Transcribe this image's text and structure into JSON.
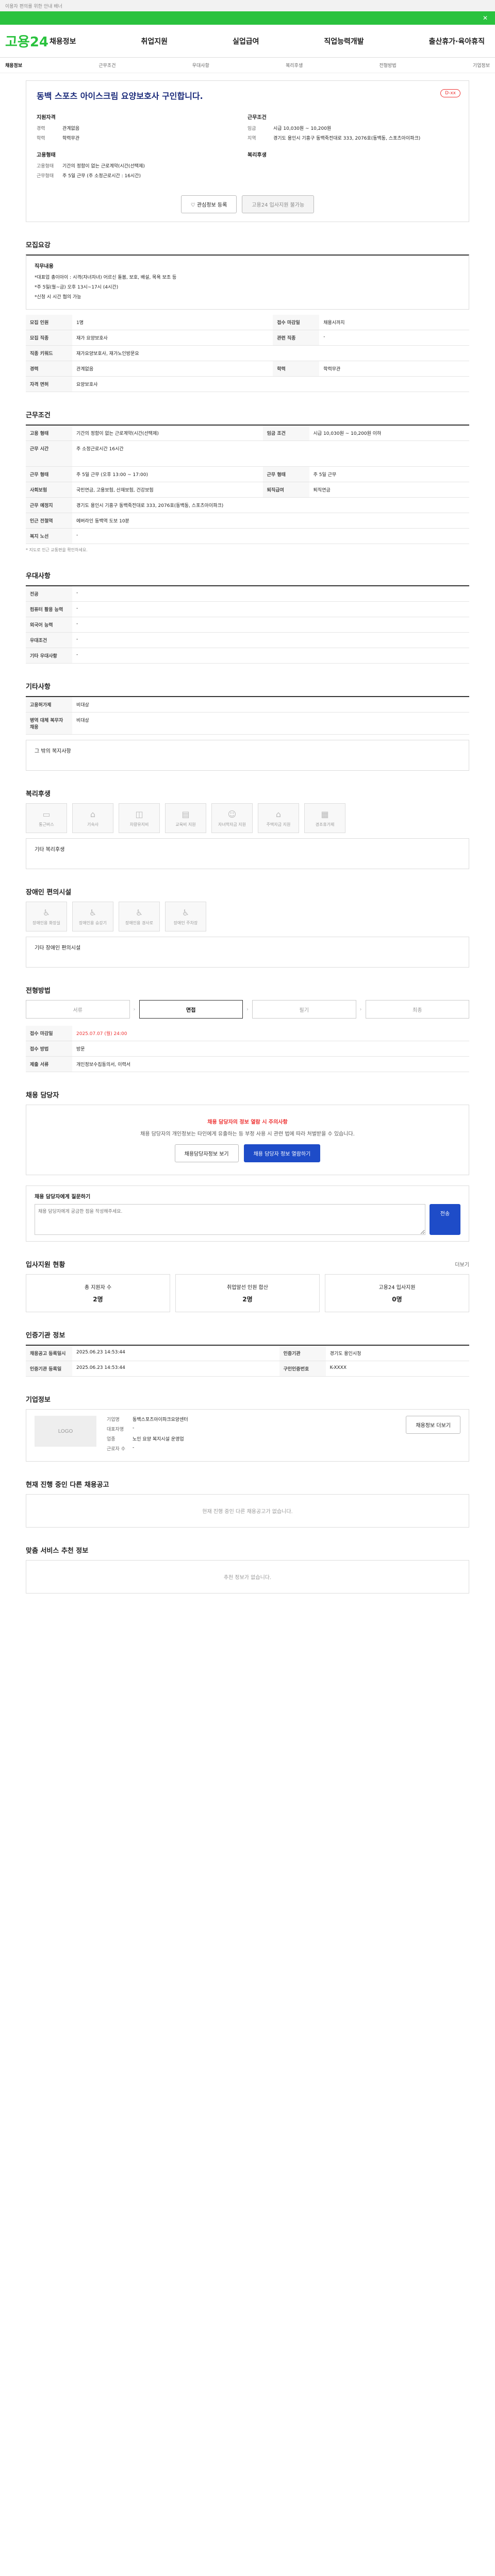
{
  "topbar": {
    "text": "이용자 편의를 위한 안내 배너"
  },
  "banner": {
    "close": "✕"
  },
  "header": {
    "logo_main": "고용",
    "logo_num": "24",
    "gnb": [
      "채용정보",
      "취업지원",
      "실업급여",
      "직업능력개발",
      "출산휴가·육아휴직"
    ]
  },
  "subnav": [
    "채용정보",
    "근무조건",
    "우대사항",
    "복리후생",
    "전형방법",
    "기업정보"
  ],
  "job": {
    "title": "동백 스포츠 아이스크림 요양보호사 구인합니다.",
    "status": "D-xx",
    "left_head": "지원자격",
    "left": [
      {
        "k": "경력",
        "v": "관계없음"
      },
      {
        "k": "학력",
        "v": "학력무관"
      }
    ],
    "left_head2": "고용형태",
    "left2": [
      {
        "k": "고용형태",
        "v": "기간의 정함이 없는 근로계약(시간(선택제)"
      },
      {
        "k": "근무형태",
        "v": "주 5일 근무 (주 소정근로시간 : 16시간)"
      }
    ],
    "right_head": "근무조건",
    "right": [
      {
        "k": "임금",
        "v": "시급 10,030원 ~ 10,200원"
      },
      {
        "k": "지역",
        "v": "경기도 용인시 기흥구 동백죽전대로 333, 2076호(동백동, 스포츠아이파크)"
      }
    ],
    "right_head2": "복리후생",
    "btn_interest": "관심정보 등록",
    "btn_apply": "고용24 입사지원 불가능"
  },
  "recruit": {
    "title": "모집요강",
    "duty_head": "직무내용",
    "duty_lines": [
      "*대표업 총이아이 : 시격(자녀자녀) 어르신 돌봄, 보호, 배설, 목욕 보조 등",
      "*주 5일(월~금) 오후 13시~17시 (4시간)",
      "*신청 시 시간 협의 가능"
    ],
    "rows": [
      [
        {
          "k": "모집 인원",
          "v": "1명"
        },
        {
          "k": "접수 마감일",
          "v": "채용시까지"
        }
      ],
      [
        {
          "k": "모집 직종",
          "v": "재가 요양보호사"
        },
        {
          "k": "관련 직종",
          "v": "-"
        }
      ],
      [
        {
          "k": "직종 키워드",
          "v": "재가요양보호사, 재가노인방문요"
        },
        {
          "k": "",
          "v": ""
        }
      ],
      [
        {
          "k": "경력",
          "v": "관계없음"
        },
        {
          "k": "학력",
          "v": "학력무관"
        }
      ],
      [
        {
          "k": "자격 면허",
          "v": "요양보호사"
        },
        {
          "k": "",
          "v": ""
        }
      ]
    ]
  },
  "work": {
    "title": "근무조건",
    "rows": [
      [
        {
          "k": "고용 형태",
          "v": "기간의 정함이 없는 근로계약(시간(선택제)"
        },
        {
          "k": "임금 조건",
          "v": "시급 10,030원 ~ 10,200원 이하"
        }
      ],
      [
        {
          "k": "근무 시간",
          "v": "주 소정근로시간 16시간"
        },
        {
          "k": "",
          "v": ""
        }
      ],
      [
        {
          "k": "근무 형태",
          "v": "주 5일 근무 (오후 13:00 ~ 17:00)"
        },
        {
          "k": "근무 형태",
          "v": "주 5일 근무"
        }
      ],
      [
        {
          "k": "사회보험",
          "v": "국민연금, 고용보험, 산재보험, 건강보험"
        },
        {
          "k": "퇴직급여",
          "v": "퇴직연금"
        }
      ],
      [
        {
          "k": "근무 예정지",
          "v": "경기도 용인시 기흥구 동백죽전대로 333, 2076호(동백동, 스포츠아이파크)"
        },
        {
          "k": "",
          "v": ""
        }
      ],
      [
        {
          "k": "인근 전철역",
          "v": "에버라인 동백역 도보 10분"
        },
        {
          "k": "",
          "v": ""
        }
      ],
      [
        {
          "k": "복지 노선",
          "v": "-"
        },
        {
          "k": "",
          "v": ""
        }
      ]
    ],
    "note": "* 지도로 인근 교통편을 확인하세요."
  },
  "pref": {
    "title": "우대사항",
    "rows": [
      {
        "k": "전공",
        "v": "-"
      },
      {
        "k": "컴퓨터 활용 능력",
        "v": "-"
      },
      {
        "k": "외국어 능력",
        "v": "-"
      },
      {
        "k": "우대조건",
        "v": "-"
      },
      {
        "k": "기타 우대사항",
        "v": "-"
      }
    ]
  },
  "etc": {
    "title": "기타사항",
    "rows": [
      {
        "k": "고용허가제",
        "v": "비대상"
      },
      {
        "k": "병역 대체 복무자 채용",
        "v": "비대상"
      }
    ]
  },
  "etc_box": "그 밖의 복지사항",
  "welfare": {
    "title": "복리후생",
    "icons": [
      "통근버스",
      "기숙사",
      "차량유지비",
      "교육비 지원",
      "자녀학자금 지원",
      "주택자금 지원",
      "경조휴가제"
    ],
    "box": "기타 복리후생"
  },
  "disabled": {
    "title": "장애인 편의시설",
    "icons": [
      "장애인용 화장실",
      "장애인용 승강기",
      "장애인용 경사로",
      "장애인 주차장"
    ],
    "box": "기타 장애인 편의시설"
  },
  "screening": {
    "title": "전형방법",
    "steps": [
      "서류",
      "면접",
      "필기",
      "최종"
    ],
    "rows": [
      {
        "k": "접수 마감일",
        "v": "2025.07.07 (월) 24:00"
      },
      {
        "k": "접수 방법",
        "v": "방문"
      },
      {
        "k": "제출 서류",
        "v": "개인정보수집동의서, 이력서"
      }
    ]
  },
  "manager": {
    "title": "채용 담당자",
    "warn_title": "채용 담당자의 정보 열람 시 주의사항",
    "warn_text": "채용 담당자의 개인정보는 타인에게 유출하는 등 부정 사용 시 관련 법에 따라 처벌받을 수 있습니다.",
    "btn1": "채용담당자정보 보기",
    "btn2": "채용 담당자 정보 열람하기"
  },
  "opinion": {
    "title": "채용 담당자에게 질문하기",
    "placeholder": "채용 담당자에게 궁금한 점을 작성해주세요.",
    "btn": "전송"
  },
  "apply_status": {
    "title": "입사지원 현황",
    "more": "더보기",
    "stats": [
      {
        "k": "총 지원자 수",
        "v": "2명"
      },
      {
        "k": "취업알선 인원 합산",
        "v": "2명"
      },
      {
        "k": "고용24 입사지원",
        "v": "0명"
      }
    ]
  },
  "authority": {
    "title": "인증기관 정보",
    "rows": [
      [
        {
          "k": "채용공고 등록일시",
          "v": "2025.06.23 14:53:44"
        },
        {
          "k": "인증기관",
          "v": "경기도 용인시청"
        }
      ],
      [
        {
          "k": "인증기관 등록일",
          "v": "2025.06.23 14:53:44"
        },
        {
          "k": "구인인증번호",
          "v": "K-XXXX"
        }
      ]
    ]
  },
  "company": {
    "title": "기업정보",
    "logo": "LOGO",
    "rows": [
      {
        "k": "기업명",
        "v": "동백스포츠아이파크요양센터"
      },
      {
        "k": "대표자명",
        "v": "-"
      },
      {
        "k": "업종",
        "v": "노인 요양 복지시설 운영업"
      },
      {
        "k": "근로자 수",
        "v": "-"
      }
    ],
    "btn_more": "채용정보 더보기"
  },
  "ongoing": {
    "title": "현재 진행 중인 다른 채용공고",
    "empty": "현재 진행 중인 다른 채용공고가 없습니다."
  },
  "similar": {
    "title": "맞춤 서비스 추천 정보",
    "empty": "추천 정보가 없습니다."
  }
}
